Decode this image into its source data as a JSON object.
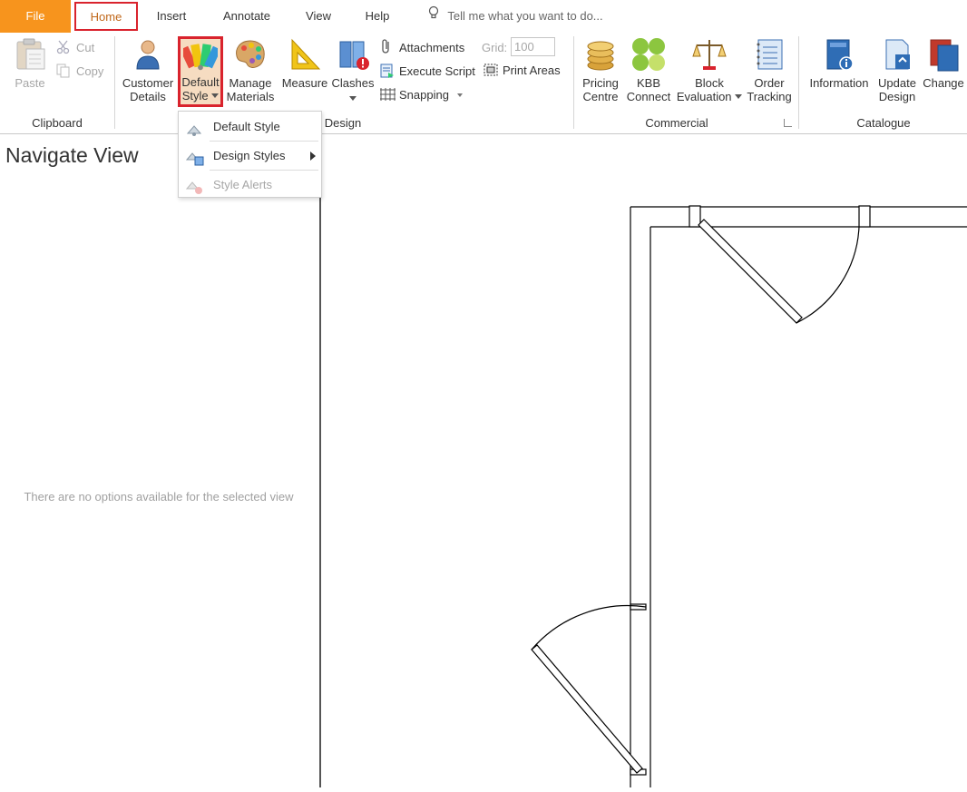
{
  "tabs": {
    "file": "File",
    "home": "Home",
    "insert": "Insert",
    "annotate": "Annotate",
    "view": "View",
    "help": "Help",
    "search_placeholder": "Tell me what you want to do..."
  },
  "clipboard": {
    "paste": "Paste",
    "cut": "Cut",
    "copy": "Copy",
    "label": "Clipboard"
  },
  "design": {
    "customer_line1": "Customer",
    "customer_line2": "Details",
    "default_style_line1": "Default",
    "default_style_line2": "Style",
    "manage_line1": "Manage",
    "manage_line2": "Materials",
    "measure": "Measure",
    "clashes": "Clashes",
    "attachments": "Attachments",
    "execute_script": "Execute Script",
    "snapping": "Snapping",
    "grid_label": "Grid:",
    "grid_value": "100",
    "print_areas": "Print Areas",
    "label": "Design"
  },
  "commercial": {
    "pricing_line1": "Pricing",
    "pricing_line2": "Centre",
    "kbb_line1": "KBB",
    "kbb_line2": "Connect",
    "block_line1": "Block",
    "block_line2": "Evaluation",
    "order_line1": "Order",
    "order_line2": "Tracking",
    "label": "Commercial"
  },
  "catalogue": {
    "information": "Information",
    "update_line1": "Update",
    "update_line2": "Design",
    "change": "Change",
    "label": "Catalogue"
  },
  "dropdown": {
    "default_style": "Default Style",
    "design_styles": "Design Styles",
    "style_alerts": "Style Alerts"
  },
  "navigate": {
    "title": "Navigate View",
    "empty_message": "There are no options available for the selected view"
  },
  "colors": {
    "file_tab": "#f7941d",
    "highlight": "#d9232d",
    "home_text": "#c0671a"
  }
}
